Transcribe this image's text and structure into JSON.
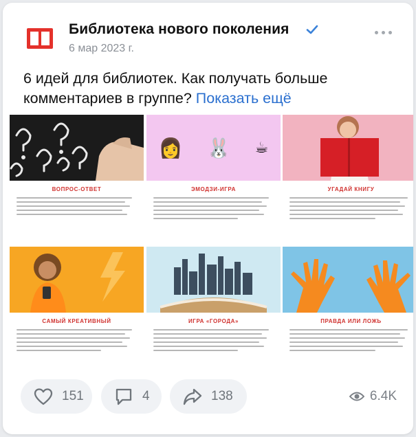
{
  "post": {
    "group_name": "Библиотека нового поколения",
    "date": "6 мар 2023 г.",
    "text": "6 идей для библиотек. Как получать больше комментариев в группе?",
    "show_more": "Показать ещё"
  },
  "collage": {
    "items": [
      {
        "caption": "ВОПРОС-ОТВЕТ",
        "image": "question-marks-chalk"
      },
      {
        "caption": "ЭМОДЗИ-ИГРА",
        "image": "emoji-row",
        "emojis": [
          "👩",
          "🐰",
          "☕"
        ]
      },
      {
        "caption": "УГАДАЙ КНИГУ",
        "image": "woman-red-book"
      },
      {
        "caption": "САМЫЙ КРЕАТИВНЫЙ",
        "image": "woman-phone-yellow"
      },
      {
        "caption": "ИГРА «ГОРОДА»",
        "image": "city-book"
      },
      {
        "caption": "ПРАВДА ИЛИ ЛОЖЬ",
        "image": "orange-hands"
      }
    ]
  },
  "footer": {
    "likes": "151",
    "comments": "4",
    "shares": "138",
    "views": "6.4K"
  },
  "colors": {
    "accent": "#2a6fcf",
    "brand_red": "#e4312b",
    "caption_red": "#d0322f"
  }
}
